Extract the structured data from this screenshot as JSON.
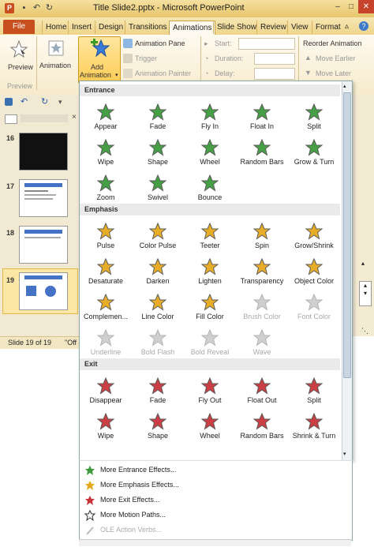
{
  "window": {
    "title": "Title Slide2.pptx  -  Microsoft PowerPoint",
    "app_icon": "P"
  },
  "tabs": [
    "File",
    "Home",
    "Insert",
    "Design",
    "Transitions",
    "Animations",
    "Slide Show",
    "Review",
    "View",
    "Format"
  ],
  "active_tab": "Animations",
  "ribbon": {
    "preview_label": "Preview",
    "preview_group": "Preview",
    "animation_label": "Animation",
    "add_animation_line1": "Add",
    "add_animation_line2": "Animation",
    "animation_pane": "Animation Pane",
    "trigger": "Trigger",
    "animation_painter": "Animation Painter",
    "start": "Start:",
    "duration": "Duration:",
    "delay": "Delay:",
    "reorder": "Reorder Animation",
    "move_earlier": "Move Earlier",
    "move_later": "Move Later"
  },
  "slides": [
    {
      "num": "16"
    },
    {
      "num": "17"
    },
    {
      "num": "18"
    },
    {
      "num": "19"
    }
  ],
  "status": {
    "slide": "Slide 19 of 19",
    "theme": "\"Off"
  },
  "gallery": {
    "entrance_title": "Entrance",
    "entrance": [
      "Appear",
      "Fade",
      "Fly In",
      "Float In",
      "Split",
      "Wipe",
      "Shape",
      "Wheel",
      "Random Bars",
      "Grow & Turn",
      "Zoom",
      "Swivel",
      "Bounce"
    ],
    "emphasis_title": "Emphasis",
    "emphasis": [
      "Pulse",
      "Color Pulse",
      "Teeter",
      "Spin",
      "Grow/Shrink",
      "Desaturate",
      "Darken",
      "Lighten",
      "Transparency",
      "Object Color",
      "Complemen...",
      "Line Color",
      "Fill Color",
      "Brush Color",
      "Font Color",
      "Underline",
      "Bold Flash",
      "Bold Reveal",
      "Wave"
    ],
    "exit_title": "Exit",
    "exit": [
      "Disappear",
      "Fade",
      "Fly Out",
      "Float Out",
      "Split",
      "Wipe",
      "Shape",
      "Wheel",
      "Random Bars",
      "Shrink & Turn"
    ]
  },
  "more": [
    "More Entrance Effects...",
    "More Emphasis Effects...",
    "More Exit Effects...",
    "More Motion Paths...",
    "OLE Action Verbs..."
  ],
  "colors": {
    "entrance": "#3c9a3c",
    "emphasis": "#e6a91e",
    "exit": "#c8343a"
  }
}
